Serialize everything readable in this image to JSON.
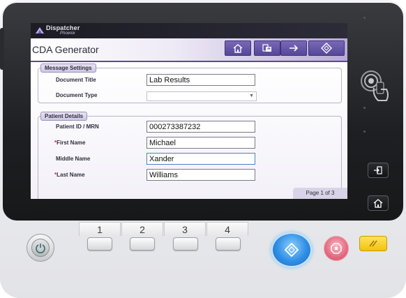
{
  "brand": {
    "name": "Dispatcher",
    "sub": "Phoenix"
  },
  "page": {
    "title": "CDA Generator",
    "indicator": "Page 1 of 3"
  },
  "toolbar": {
    "icons": [
      "home-icon",
      "scan-to-destination-icon",
      "arrow-right-icon",
      "start-diamond-icon"
    ]
  },
  "message_settings": {
    "legend": "Message Settings",
    "document_title": {
      "label": "Document Title",
      "value": "Lab Results"
    },
    "document_type": {
      "label": "Document Type",
      "value": ""
    }
  },
  "patient_details": {
    "legend": "Patient Details",
    "patient_id": {
      "label": "Patient ID / MRN",
      "value": "000273387232"
    },
    "first_name": {
      "required_mark": "*",
      "label": "First Name",
      "value": "Michael"
    },
    "middle_name": {
      "label": "Middle Name",
      "value": "Xander"
    },
    "last_name": {
      "required_mark": "*",
      "label": "Last Name",
      "value": "Williams"
    }
  },
  "hardware": {
    "number_tabs": [
      "1",
      "2",
      "3",
      "4"
    ],
    "colors": {
      "accent": "#55479a",
      "start": "#2f8fe5",
      "stop": "#e46a80",
      "reset": "#f2c20f"
    }
  }
}
